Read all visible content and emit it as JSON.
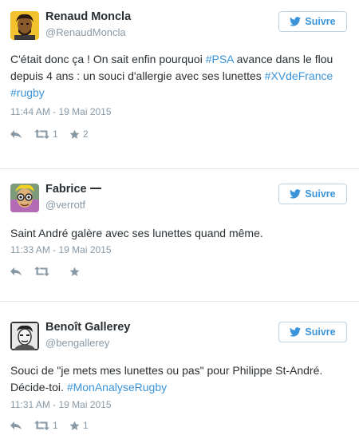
{
  "follow_label": "Suivre",
  "colors": {
    "link": "#3b94d9",
    "muted": "#8899a6",
    "text": "#292f33",
    "border": "#e1e8ed"
  },
  "tweets": [
    {
      "name": "Renaud Moncla",
      "handle": "@RenaudMoncla",
      "text": {
        "t1": "C'était donc ça ! On sait enfin pourquoi ",
        "h1": "#PSA",
        "t2": " avance dans le flou depuis 4 ans : un souci d'allergie avec ses lunettes ",
        "h2": "#XVdeFrance",
        "t3": " ",
        "h3": "#rugby"
      },
      "time": "11:44 AM - 19 Mai 2015",
      "retweets": "1",
      "favorites": "2"
    },
    {
      "name": "Fabrice",
      "handle": "@verrotf",
      "text": {
        "t1": "Saint André galère avec ses lunettes quand même."
      },
      "time": "11:33 AM - 19 Mai 2015",
      "retweets": "",
      "favorites": ""
    },
    {
      "name": "Benoît Gallerey",
      "handle": "@bengallerey",
      "text": {
        "t1": "Souci de \"je mets mes lunettes ou pas\" pour Philippe St-André. Décide-toi. ",
        "h1": "#MonAnalyseRugby"
      },
      "time": "11:31 AM - 19 Mai 2015",
      "retweets": "1",
      "favorites": "1"
    }
  ]
}
